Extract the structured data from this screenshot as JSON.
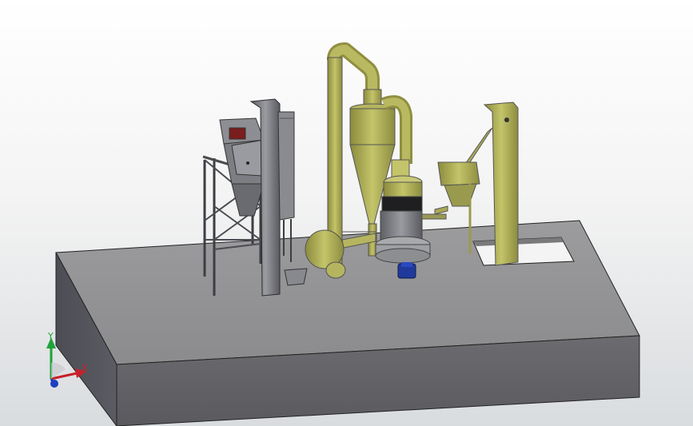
{
  "viewport": {
    "background_top": "#ffffff",
    "background_bottom": "#d9dcdf"
  },
  "model": {
    "platform_color": "#8a8a8c",
    "machine_color": "#a9a957",
    "steel_color": "#6e6f74",
    "motor_color": "#1f3a9a"
  },
  "triad": {
    "x_label": "X",
    "y_label": "Y",
    "x_color": "#c8202a",
    "y_color": "#1fa33a",
    "z_color": "#1d3fc0"
  }
}
